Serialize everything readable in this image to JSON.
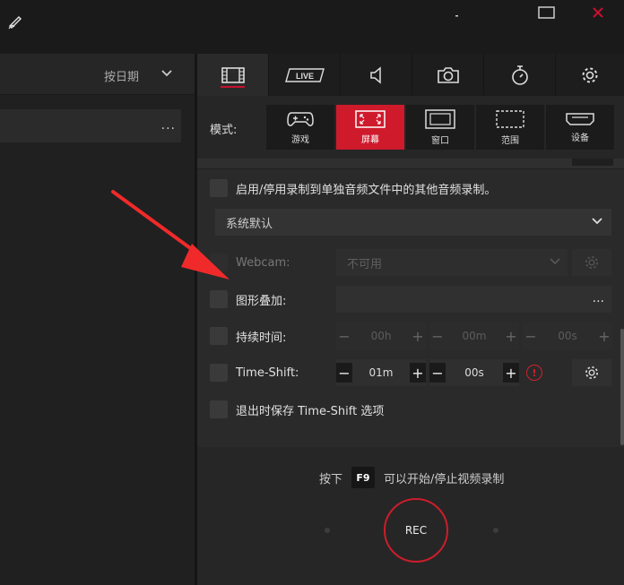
{
  "left": {
    "sort_label": "按日期",
    "more": "..."
  },
  "tabs": [
    {
      "name": "video-record",
      "label": "",
      "icon": "film-icon"
    },
    {
      "name": "live",
      "label": "LIVE",
      "icon": "live-icon"
    },
    {
      "name": "audio",
      "label": "",
      "icon": "speaker-icon"
    },
    {
      "name": "screenshot",
      "label": "",
      "icon": "camera-icon"
    },
    {
      "name": "timer",
      "label": "",
      "icon": "stopwatch-icon"
    },
    {
      "name": "settings",
      "label": "",
      "icon": "gear-icon"
    }
  ],
  "mode": {
    "label": "模式:",
    "items": [
      {
        "label": "游戏",
        "icon": "gamepad-icon"
      },
      {
        "label": "屏幕",
        "icon": "fullscreen-icon",
        "active": true
      },
      {
        "label": "窗口",
        "icon": "window-icon"
      },
      {
        "label": "范围",
        "icon": "region-icon"
      },
      {
        "label": "设备",
        "icon": "hdmi-icon"
      }
    ]
  },
  "options": {
    "separate_audio_label": "启用/停用录制到单独音频文件中的其他音频录制。",
    "audio_device": "系统默认",
    "webcam_label": "Webcam:",
    "webcam_value": "不可用",
    "overlay_label": "图形叠加:",
    "overlay_more": "...",
    "duration_label": "持续时间:",
    "duration_h": "00h",
    "duration_m": "00m",
    "duration_s": "00s",
    "timeshift_label": "Time-Shift:",
    "timeshift_m": "01m",
    "timeshift_s": "00s",
    "warn": "!",
    "save_timeshift_label": "退出时保存 Time-Shift 选项"
  },
  "bottom": {
    "hint_before": "按下",
    "hotkey": "F9",
    "hint_after": "可以开始/停止视频录制",
    "rec_label": "REC"
  },
  "colors": {
    "accent": "#cf1a2c",
    "arrow": "#f02a2a"
  }
}
